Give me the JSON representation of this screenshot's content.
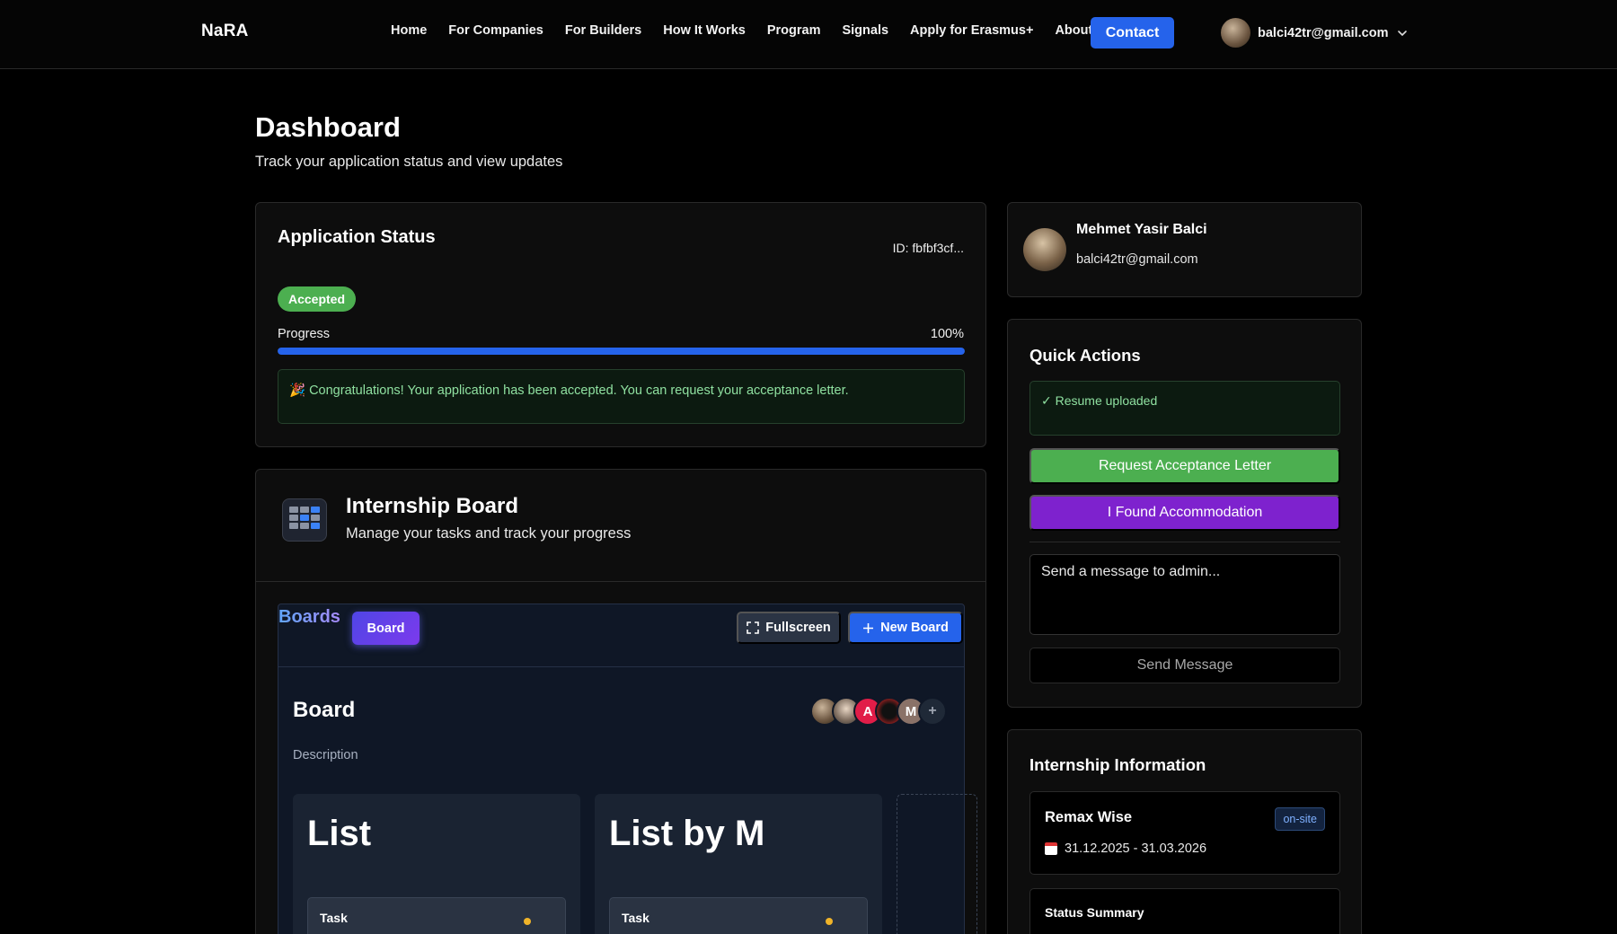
{
  "header": {
    "logo": "NaRA",
    "nav": [
      "Home",
      "For Companies",
      "For Builders",
      "How It Works",
      "Program",
      "Signals",
      "Apply for Erasmus+",
      "About"
    ],
    "contact_label": "Contact",
    "user_email": "balci42tr@gmail.com"
  },
  "page": {
    "title": "Dashboard",
    "subtitle": "Track your application status and view updates"
  },
  "application_status": {
    "title": "Application Status",
    "id": "ID: fbfbf3cf...",
    "status_badge": "Accepted",
    "progress_label": "Progress",
    "progress_text": "100%",
    "progress_value": 100,
    "message": "🎉 Congratulations! Your application has been accepted. You can request your acceptance letter."
  },
  "internship_board": {
    "title": "Internship Board",
    "subtitle": "Manage your tasks and track your progress",
    "boards_label": "Boards",
    "active_tab": "Board",
    "fullscreen_label": "Fullscreen",
    "new_board_label": "New Board",
    "board_name": "Board",
    "board_description": "Description",
    "members": [
      "",
      "",
      "A",
      "",
      "M",
      "+"
    ],
    "lists": [
      {
        "title": "List",
        "tasks": [
          {
            "label": "Task"
          }
        ]
      },
      {
        "title": "List by M",
        "tasks": [
          {
            "label": "Task"
          }
        ]
      }
    ]
  },
  "profile": {
    "name": "Mehmet Yasir Balci",
    "email": "balci42tr@gmail.com"
  },
  "quick_actions": {
    "title": "Quick Actions",
    "resume_status": "✓ Resume uploaded",
    "request_letter_label": "Request Acceptance Letter",
    "accommodation_label": "I Found Accommodation",
    "message_placeholder": "Send a message to admin...",
    "send_label": "Send Message"
  },
  "internship_info": {
    "title": "Internship Information",
    "company": "Remax Wise",
    "work_mode": "on-site",
    "dates": "31.12.2025 - 31.03.2026",
    "status_summary_label": "Status Summary"
  },
  "colors": {
    "accent_blue": "#2563eb",
    "success_green": "#4caf50",
    "accommodation_purple": "#7e22ce"
  }
}
